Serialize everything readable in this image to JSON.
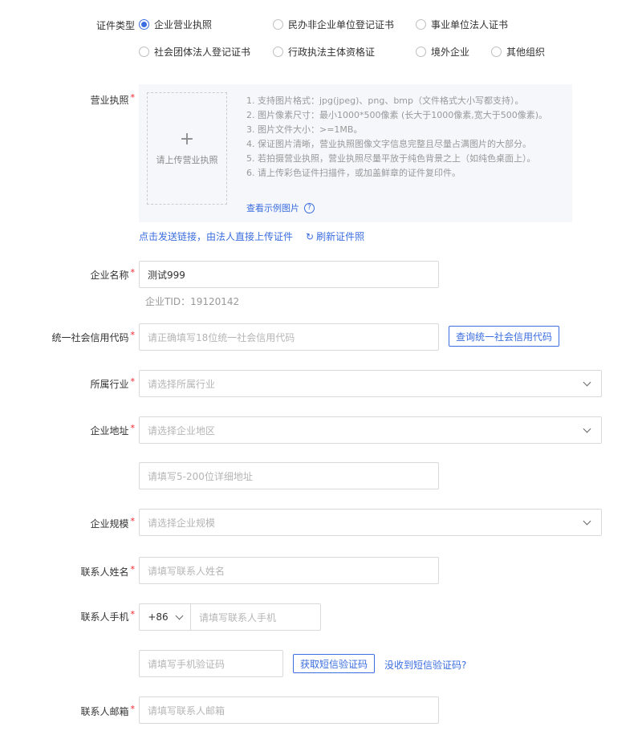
{
  "cert_type": {
    "label": "证件类型",
    "options": [
      "企业营业执照",
      "民办非企业单位登记证书",
      "事业单位法人证书",
      "社会团体法人登记证书",
      "行政执法主体资格证",
      "境外企业",
      "其他组织"
    ],
    "selected": "企业营业执照"
  },
  "license": {
    "label": "营业执照",
    "required": "*",
    "upload_plus": "+",
    "upload_text": "请上传营业执照",
    "tips": [
      "1. 支持图片格式：jpg(jpeg)、png、bmp（文件格式大小写都支持）。",
      "2. 图片像素尺寸：最小1000*500像素 (长大于1000像素,宽大于500像素)。",
      "3. 图片文件大小：>=1MB。",
      "4. 保证图片清晰，营业执照图像文字信息完整且尽量占满图片的大部分。",
      "5. 若拍摄营业执照，营业执照尽量平放于纯色背景之上（如纯色桌面上）。",
      "6. 请上传彩色证件扫描件，或加盖鲜章的证件复印件。"
    ],
    "example_link": "查看示例图片",
    "help_icon": "?",
    "send_link": "点击发送链接，由法人直接上传证件",
    "refresh_icon": "↻",
    "refresh_link": "刷新证件照"
  },
  "company_name": {
    "label": "企业名称",
    "required": "*",
    "value": "测试999",
    "tid": "企业TID：19120142"
  },
  "credit_code": {
    "label": "统一社会信用代码",
    "required": "*",
    "placeholder": "请正确填写18位统一社会信用代码",
    "button": "查询统一社会信用代码"
  },
  "industry": {
    "label": "所属行业",
    "required": "*",
    "placeholder": "请选择所属行业"
  },
  "address": {
    "label": "企业地址",
    "required": "*",
    "region_placeholder": "请选择企业地区",
    "detail_placeholder": "请填写5-200位详细地址"
  },
  "scale": {
    "label": "企业规模",
    "required": "*",
    "placeholder": "请选择企业规模"
  },
  "contact_name": {
    "label": "联系人姓名",
    "required": "*",
    "placeholder": "请填写联系人姓名"
  },
  "contact_phone": {
    "label": "联系人手机",
    "required": "*",
    "prefix": "+86",
    "placeholder": "请填写联系人手机",
    "code_placeholder": "请填写手机验证码",
    "code_button": "获取短信验证码",
    "no_code_link": "没收到短信验证码?"
  },
  "contact_email": {
    "label": "联系人邮箱",
    "required": "*",
    "placeholder": "请填写联系人邮箱"
  },
  "colors": {
    "accent": "#3b6ee0",
    "required": "#f5222d",
    "panel_bg": "#f5f7fa"
  }
}
